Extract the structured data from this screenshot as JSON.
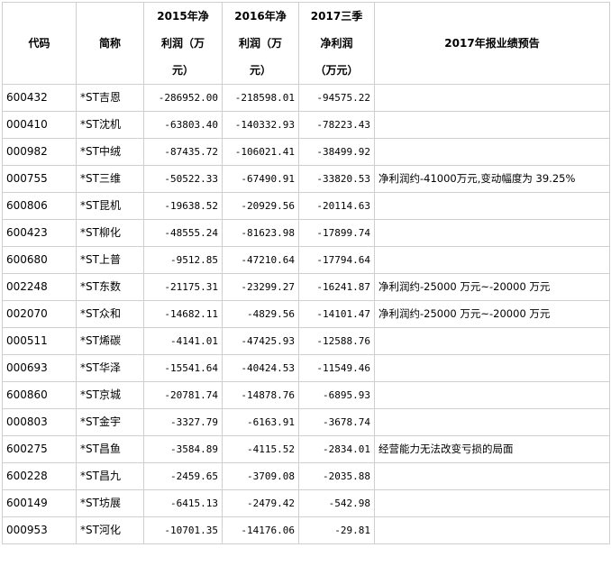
{
  "table": {
    "headers": {
      "code": "代码",
      "name": "简称",
      "p2015": [
        "2015年净",
        "利润（万",
        "元）"
      ],
      "p2016": [
        "2016年净",
        "利润（万",
        "元）"
      ],
      "p2017q3": [
        "2017三季",
        "净利润",
        "（万元）"
      ],
      "forecast": "2017年报业绩预告"
    },
    "rows": [
      {
        "code": "600432",
        "name": "*ST吉恩",
        "p2015": "-286952.00",
        "p2016": "-218598.01",
        "p2017q3": "-94575.22",
        "forecast": ""
      },
      {
        "code": "000410",
        "name": "*ST沈机",
        "p2015": "-63803.40",
        "p2016": "-140332.93",
        "p2017q3": "-78223.43",
        "forecast": ""
      },
      {
        "code": "000982",
        "name": "*ST中绒",
        "p2015": "-87435.72",
        "p2016": "-106021.41",
        "p2017q3": "-38499.92",
        "forecast": ""
      },
      {
        "code": "000755",
        "name": "*ST三维",
        "p2015": "-50522.33",
        "p2016": "-67490.91",
        "p2017q3": "-33820.53",
        "forecast": "净利润约-41000万元,变动幅度为 39.25%"
      },
      {
        "code": "600806",
        "name": "*ST昆机",
        "p2015": "-19638.52",
        "p2016": "-20929.56",
        "p2017q3": "-20114.63",
        "forecast": ""
      },
      {
        "code": "600423",
        "name": "*ST柳化",
        "p2015": "-48555.24",
        "p2016": "-81623.98",
        "p2017q3": "-17899.74",
        "forecast": ""
      },
      {
        "code": "600680",
        "name": "*ST上普",
        "p2015": "-9512.85",
        "p2016": "-47210.64",
        "p2017q3": "-17794.64",
        "forecast": ""
      },
      {
        "code": "002248",
        "name": "*ST东数",
        "p2015": "-21175.31",
        "p2016": "-23299.27",
        "p2017q3": "-16241.87",
        "forecast": "净利润约-25000 万元~-20000 万元"
      },
      {
        "code": "002070",
        "name": "*ST众和",
        "p2015": "-14682.11",
        "p2016": "-4829.56",
        "p2017q3": "-14101.47",
        "forecast": "净利润约-25000 万元~-20000 万元"
      },
      {
        "code": "000511",
        "name": "*ST烯碳",
        "p2015": "-4141.01",
        "p2016": "-47425.93",
        "p2017q3": "-12588.76",
        "forecast": ""
      },
      {
        "code": "000693",
        "name": "*ST华泽",
        "p2015": "-15541.64",
        "p2016": "-40424.53",
        "p2017q3": "-11549.46",
        "forecast": ""
      },
      {
        "code": "600860",
        "name": "*ST京城",
        "p2015": "-20781.74",
        "p2016": "-14878.76",
        "p2017q3": "-6895.93",
        "forecast": ""
      },
      {
        "code": "000803",
        "name": "*ST金宇",
        "p2015": "-3327.79",
        "p2016": "-6163.91",
        "p2017q3": "-3678.74",
        "forecast": ""
      },
      {
        "code": "600275",
        "name": "*ST昌鱼",
        "p2015": "-3584.89",
        "p2016": "-4115.52",
        "p2017q3": "-2834.01",
        "forecast": "经营能力无法改变亏损的局面"
      },
      {
        "code": "600228",
        "name": "*ST昌九",
        "p2015": "-2459.65",
        "p2016": "-3709.08",
        "p2017q3": "-2035.88",
        "forecast": ""
      },
      {
        "code": "600149",
        "name": "*ST坊展",
        "p2015": "-6415.13",
        "p2016": "-2479.42",
        "p2017q3": "-542.98",
        "forecast": ""
      },
      {
        "code": "000953",
        "name": "*ST河化",
        "p2015": "-10701.35",
        "p2016": "-14176.06",
        "p2017q3": "-29.81",
        "forecast": ""
      }
    ]
  }
}
